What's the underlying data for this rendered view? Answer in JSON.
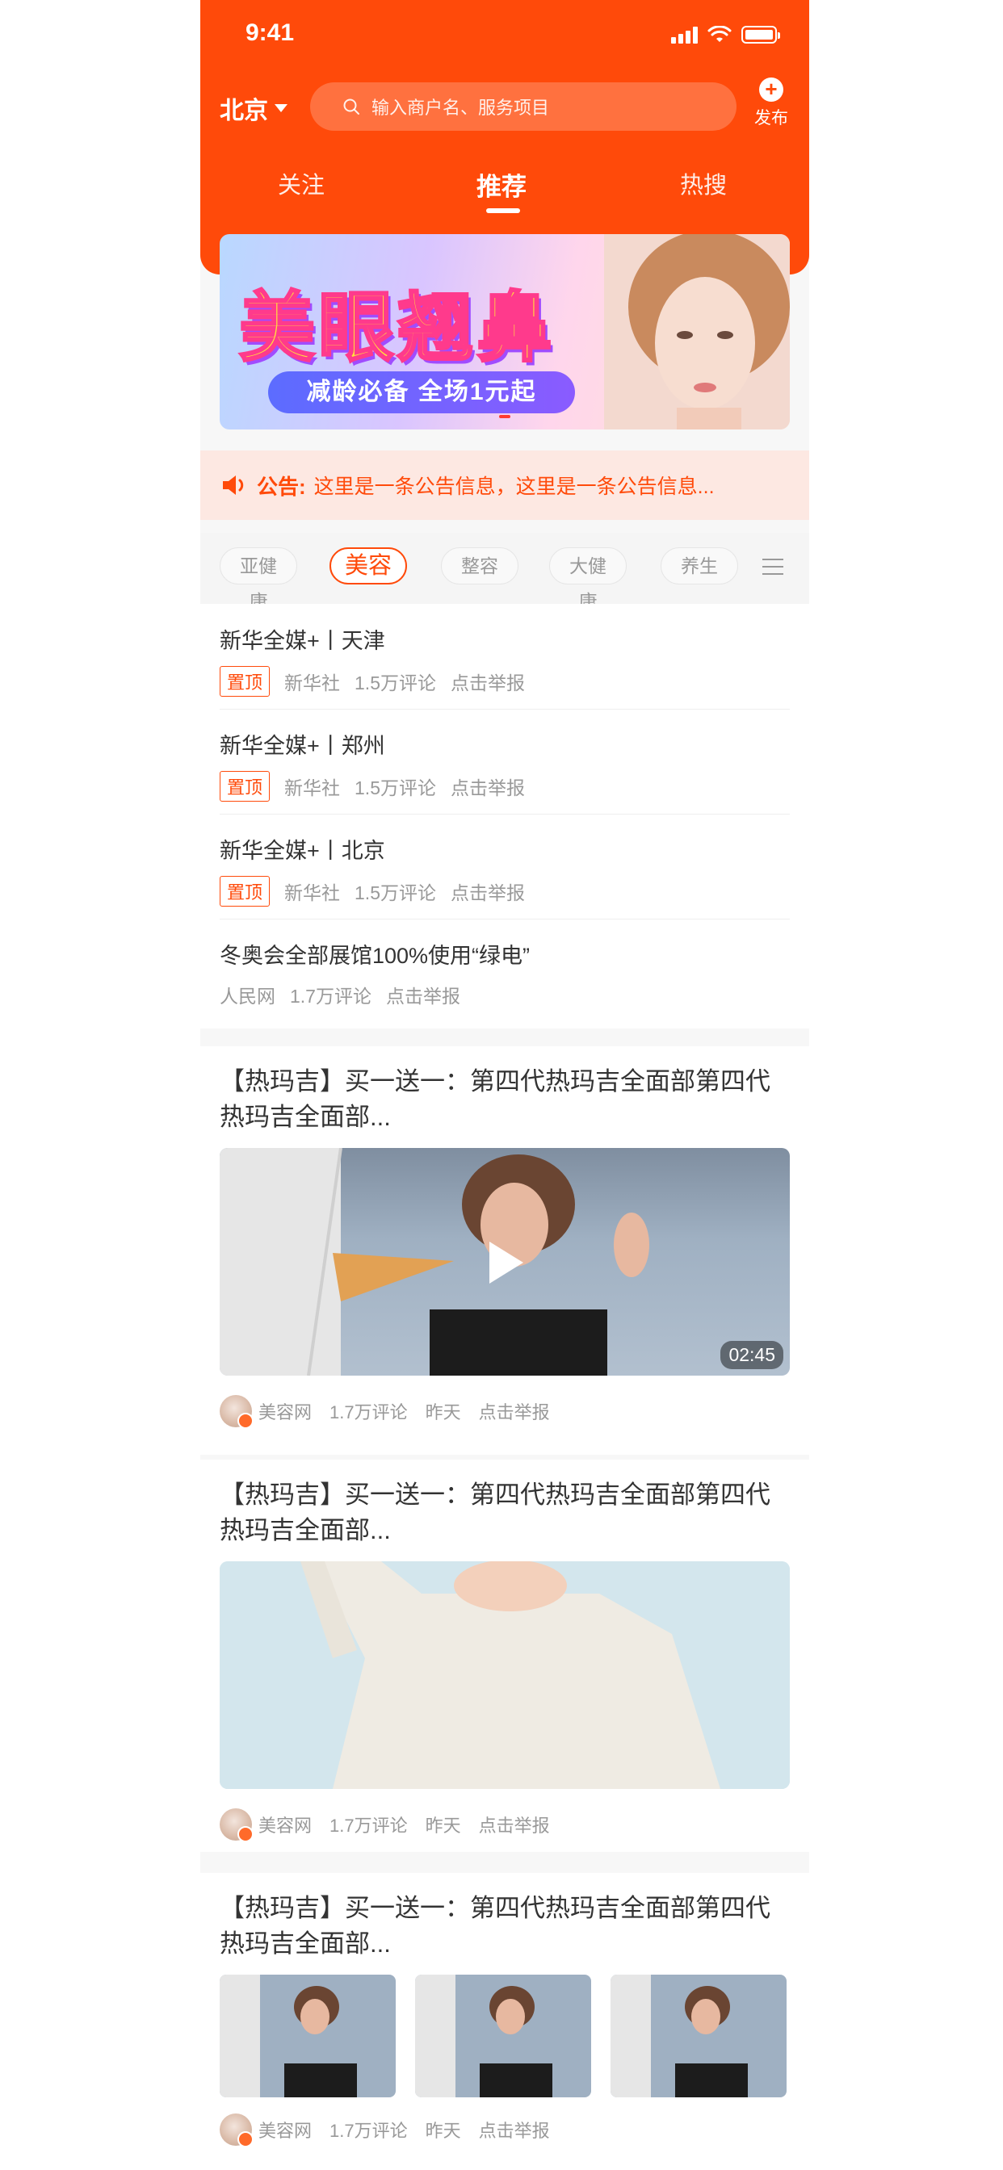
{
  "status_bar": {
    "time": "9:41"
  },
  "header": {
    "city": "北京",
    "search_placeholder": "输入商户名、服务项目",
    "publish_label": "发布",
    "tabs": [
      {
        "label": "关注",
        "active": false
      },
      {
        "label": "推荐",
        "active": true
      },
      {
        "label": "热搜",
        "active": false
      }
    ]
  },
  "banner": {
    "title": "美眼翘鼻",
    "subtitle": "减龄必备 全场1元起"
  },
  "notice": {
    "label": "公告:",
    "message": "这里是一条公告信息，这里是一条公告信息..."
  },
  "categories": {
    "items": [
      "亚健康",
      "美容",
      "整容",
      "大健康",
      "养生"
    ],
    "active": "美容"
  },
  "news": [
    {
      "title": "新华全媒+丨天津",
      "tag": "置顶",
      "source": "新华社",
      "comments": "1.5万评论",
      "report": "点击举报"
    },
    {
      "title": "新华全媒+丨郑州",
      "tag": "置顶",
      "source": "新华社",
      "comments": "1.5万评论",
      "report": "点击举报"
    },
    {
      "title": "新华全媒+丨北京",
      "tag": "置顶",
      "source": "新华社",
      "comments": "1.5万评论",
      "report": "点击举报"
    },
    {
      "title": "冬奥会全部展馆100%使用“绿电”",
      "tag": "",
      "source": "人民网",
      "comments": "1.7万评论",
      "report": "点击举报"
    }
  ],
  "cards": [
    {
      "title": "【热玛吉】买一送一：第四代热玛吉全面部第四代热玛吉全面部...",
      "media_type": "video",
      "duration": "02:45",
      "source": "美容网",
      "comments": "1.7万评论",
      "time": "昨天",
      "report": "点击举报"
    },
    {
      "title": "【热玛吉】买一送一：第四代热玛吉全面部第四代热玛吉全面部...",
      "media_type": "image",
      "source": "美容网",
      "comments": "1.7万评论",
      "time": "昨天",
      "report": "点击举报"
    },
    {
      "title": "【热玛吉】买一送一：第四代热玛吉全面部第四代热玛吉全面部...",
      "media_type": "three-images",
      "source": "美容网",
      "comments": "1.7万评论",
      "time": "昨天",
      "report": "点击举报"
    }
  ],
  "colors": {
    "accent": "#ff4a0a",
    "notice_bg": "#fde8e2"
  },
  "icons": [
    "signal-icon",
    "wifi-icon",
    "battery-icon",
    "caret-down-icon",
    "search-icon",
    "plus-icon",
    "speaker-icon",
    "menu-icon",
    "play-icon",
    "avatar"
  ]
}
